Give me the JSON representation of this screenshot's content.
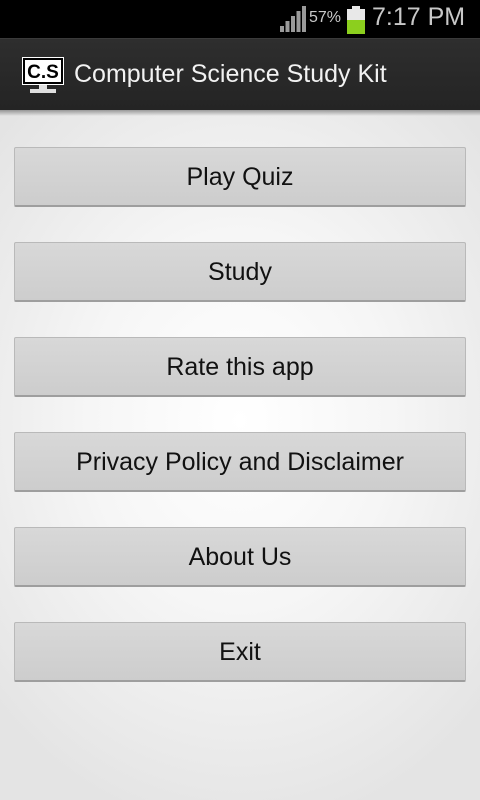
{
  "status_bar": {
    "battery_percent": "57%",
    "time": "7:17 PM",
    "signal_icon": "signal-bars-icon",
    "battery_icon": "battery-icon",
    "battery_color": "#8ccf1e"
  },
  "app_bar": {
    "icon_label": "C.S",
    "title": "Computer Science Study Kit"
  },
  "menu": {
    "buttons": [
      {
        "label": "Play Quiz"
      },
      {
        "label": "Study"
      },
      {
        "label": "Rate this app"
      },
      {
        "label": "Privacy Policy and Disclaimer"
      },
      {
        "label": "About Us"
      },
      {
        "label": "Exit"
      }
    ]
  }
}
